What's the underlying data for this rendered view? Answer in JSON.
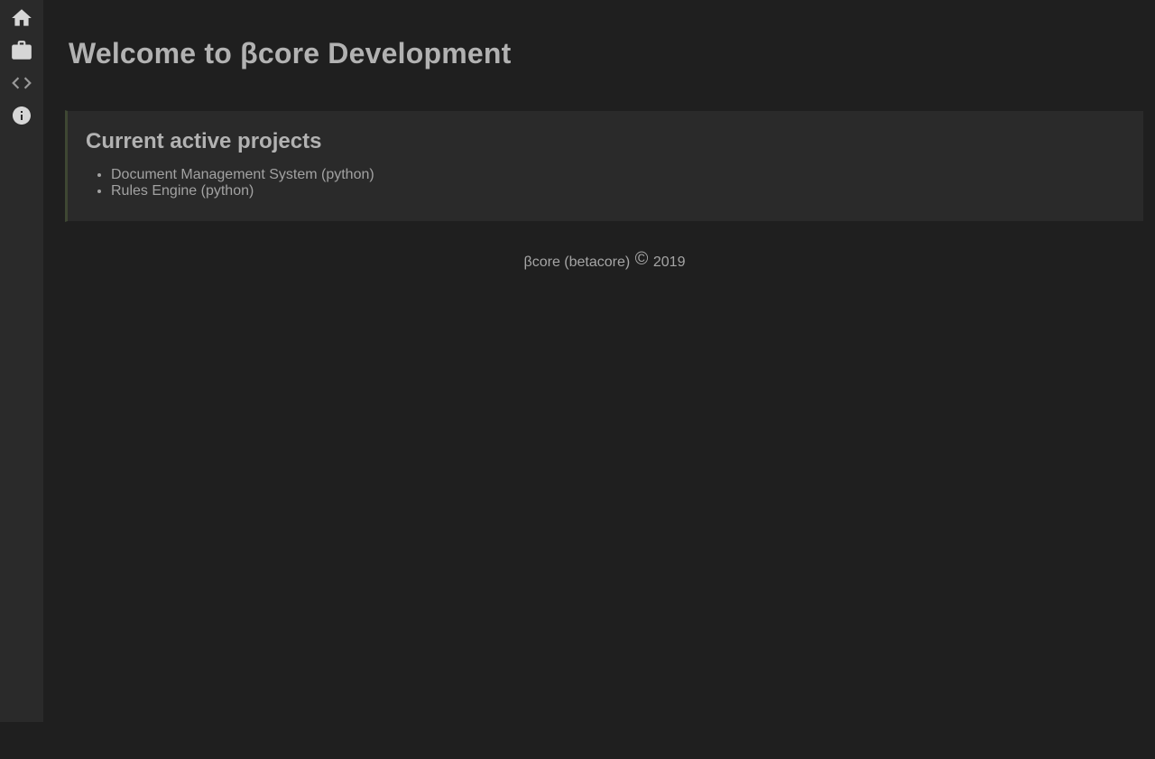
{
  "page": {
    "title": "Welcome to βcore Development"
  },
  "sidebar": {
    "icons": [
      "home-icon",
      "briefcase-icon",
      "code-icon",
      "info-icon"
    ]
  },
  "projects_card": {
    "title": "Current active projects",
    "items": [
      "Document Management System (python)",
      "Rules Engine (python)"
    ]
  },
  "footer": {
    "name": "βcore (betacore)",
    "copyright_symbol": "©",
    "year": "2019"
  },
  "colors": {
    "page_bg": "#1f1f1f",
    "sidebar_bg": "#2a2a2a",
    "card_bg": "#2a2a2a",
    "card_left_border": "#3e4733",
    "heading_text": "#b2b2b2",
    "body_text": "#a2a2a2",
    "icon_bright": "#d6d6d6",
    "icon_dim": "#9a9a9a"
  }
}
